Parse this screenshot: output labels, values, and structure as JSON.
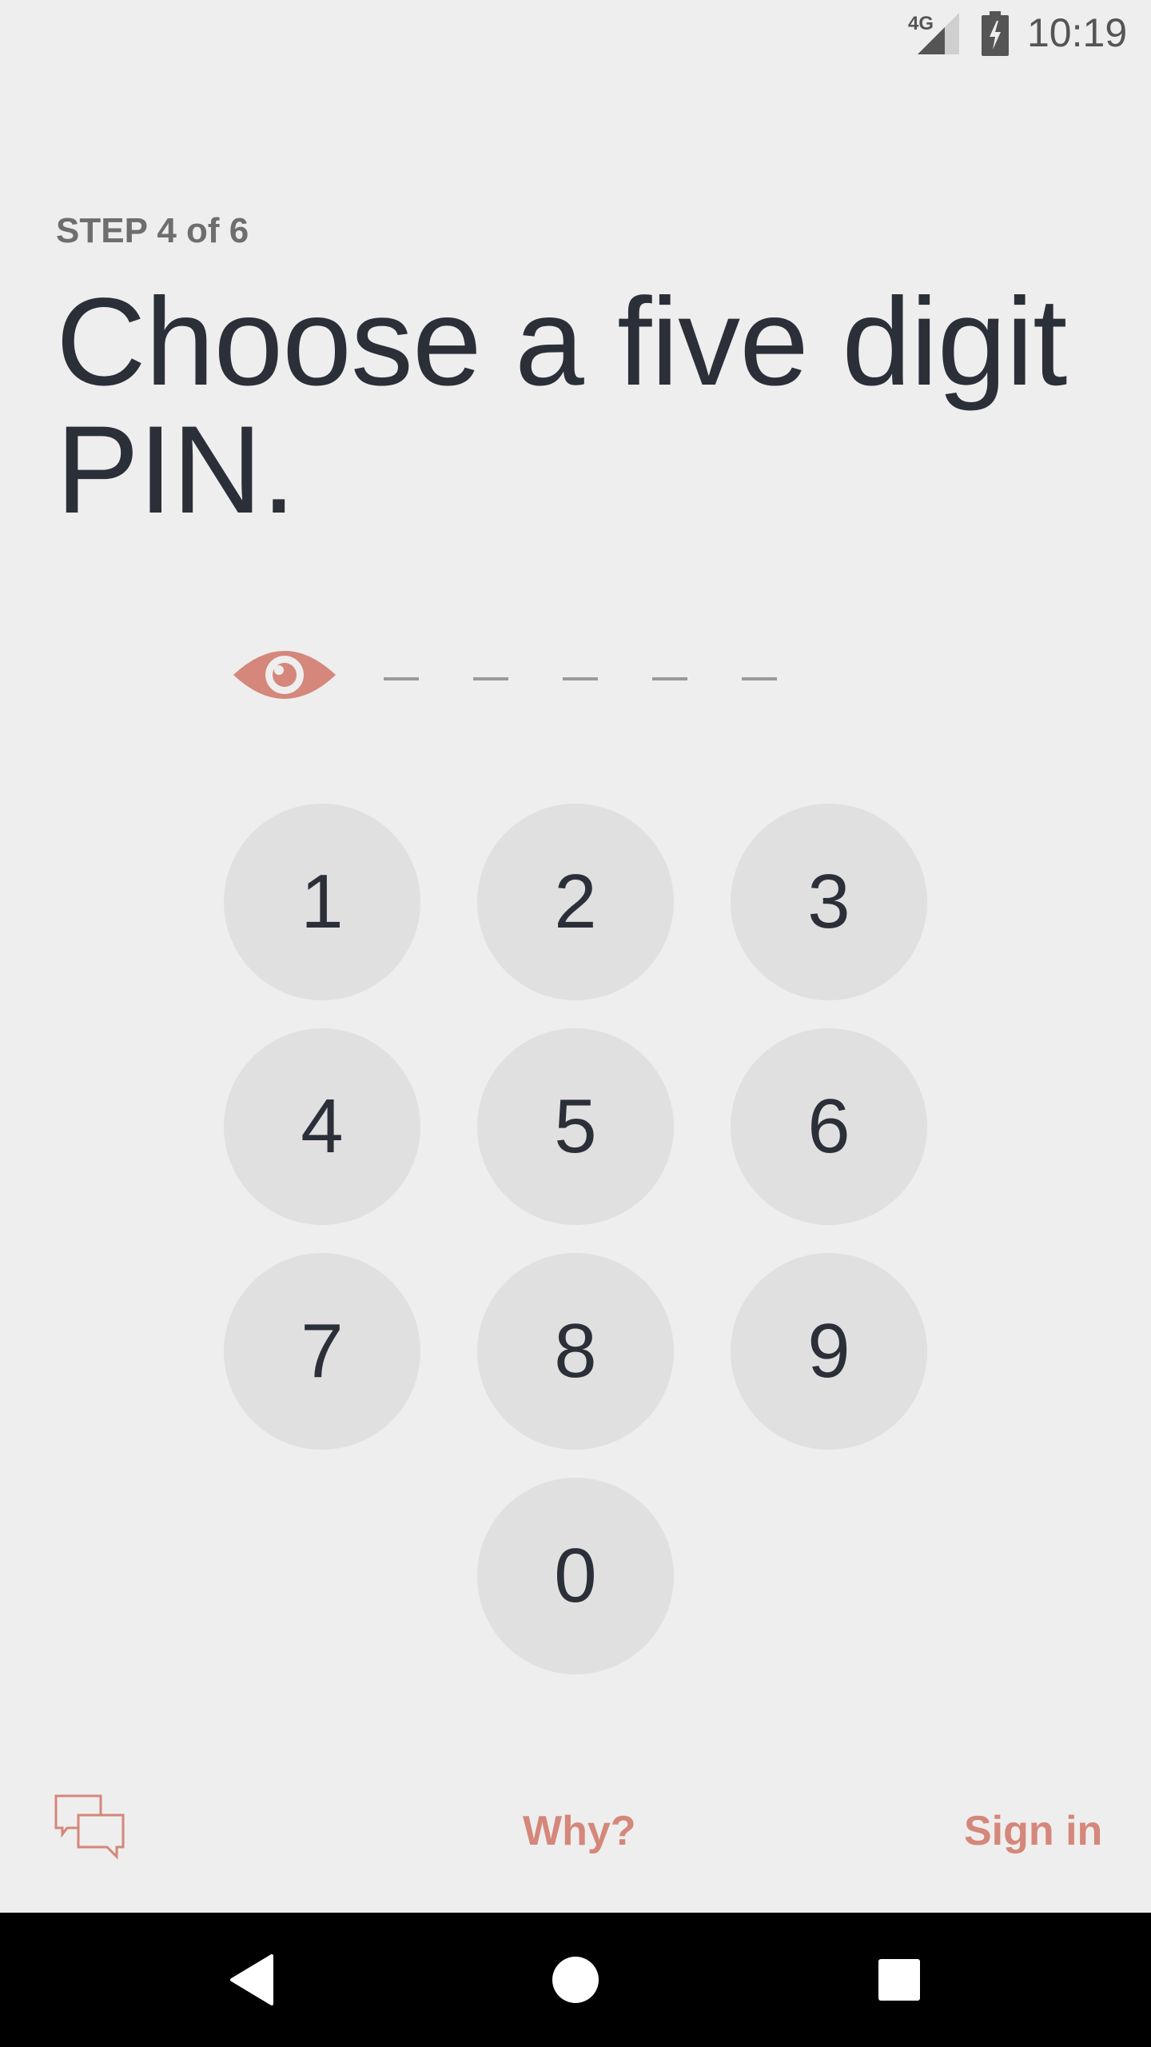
{
  "status_bar": {
    "network": "4G",
    "time": "10:19"
  },
  "step_label": "STEP 4 of 6",
  "title": "Choose a five digit PIN.",
  "pin": {
    "length": 5,
    "entered": 0
  },
  "keypad": {
    "keys": [
      "1",
      "2",
      "3",
      "4",
      "5",
      "6",
      "7",
      "8",
      "9",
      "0"
    ]
  },
  "bottom": {
    "why_label": "Why?",
    "signin_label": "Sign in"
  },
  "colors": {
    "accent": "#d4877a",
    "background": "#eeeeee",
    "key_fill": "#e0e0e0",
    "text_dark": "#2b2f38"
  },
  "icons": {
    "reveal": "eye-icon",
    "chat": "chat-icon",
    "back": "back-icon",
    "home": "home-icon",
    "recents": "recents-icon"
  }
}
